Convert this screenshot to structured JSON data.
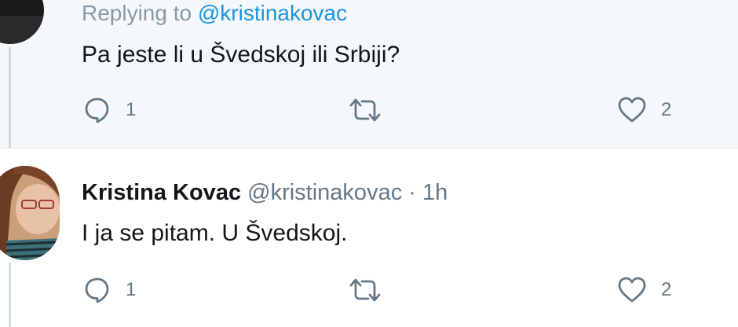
{
  "tweets": [
    {
      "replying_prefix": "Replying to",
      "replying_handle": "@kristinakovac",
      "text": "Pa jeste li u Švedskoj ili Srbiji?",
      "actions": {
        "reply_count": "1",
        "like_count": "2"
      }
    },
    {
      "author_name": "Kristina Kovac",
      "author_handle": "@kristinakovac",
      "separator": "·",
      "time": "1h",
      "text": "I ja se pitam. U Švedskoj.",
      "actions": {
        "reply_count": "1",
        "like_count": "2"
      }
    }
  ],
  "colors": {
    "muted": "#657786",
    "link": "#1b95e0",
    "text": "#14171a",
    "highlight_bg": "#f5f8fa"
  },
  "icons": [
    "reply-icon",
    "retweet-icon",
    "like-icon"
  ]
}
